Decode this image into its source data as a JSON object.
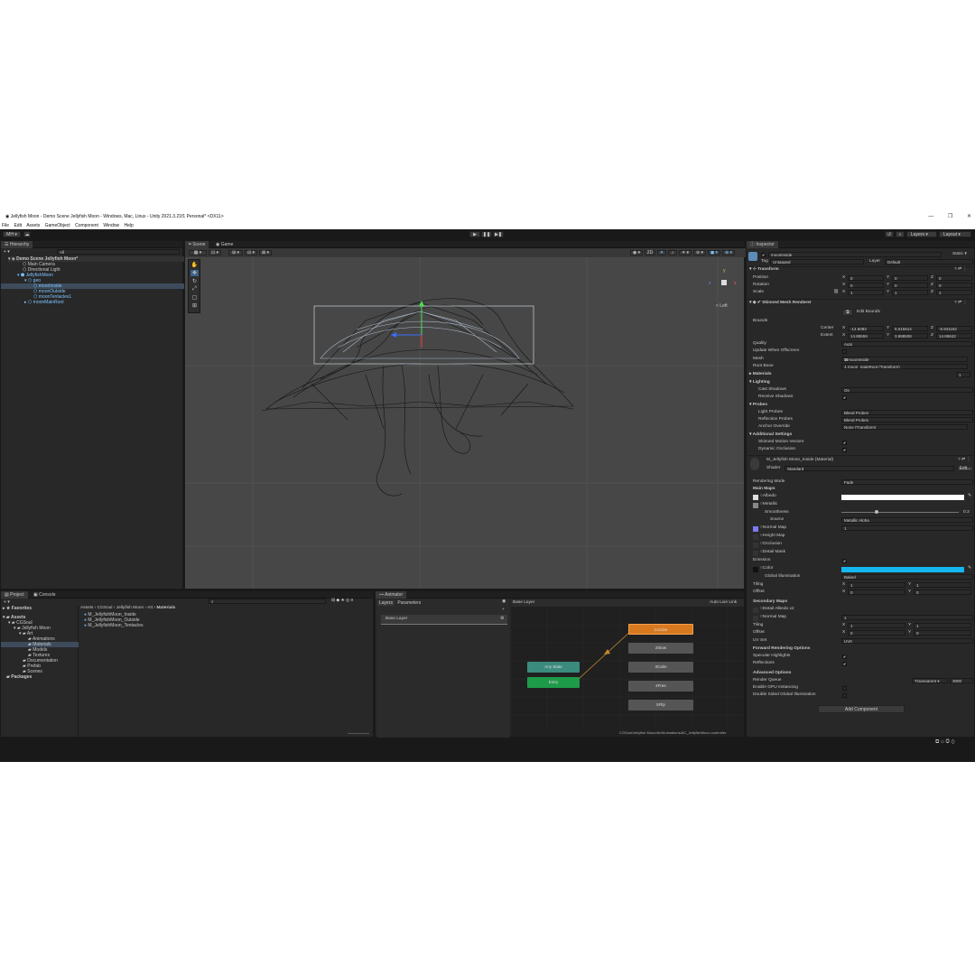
{
  "window": {
    "title": "Jellyfish Moon - Demo Scene Jellyfish Moon - Windows, Mac, Linux - Unity 2021.3.21f1 Personal* <DX11>",
    "controls": [
      "—",
      "❐",
      "✕"
    ]
  },
  "menu": [
    "File",
    "Edit",
    "Assets",
    "GameObject",
    "Component",
    "Window",
    "Help"
  ],
  "toolbar": {
    "account": "MH",
    "play": "▶",
    "pause": "❚❚",
    "step": "▶❚",
    "layers": "Layers",
    "layout": "Layout"
  },
  "hierarchy": {
    "tab": "Hierarchy",
    "add": "+ ▾",
    "search_placeholder": "All",
    "items": [
      {
        "label": "Demo Scene Jellyfish Moon*"
      },
      {
        "label": "Main Camera"
      },
      {
        "label": "Directional Light"
      },
      {
        "label": "JellyfishMoon"
      },
      {
        "label": "geo"
      },
      {
        "label": "moonInside"
      },
      {
        "label": "moonOutside"
      },
      {
        "label": "moonTentacles1"
      },
      {
        "label": "moonMainRoot"
      }
    ]
  },
  "scene": {
    "tabs": [
      "Scene",
      "Game"
    ],
    "persp_label": "< Left",
    "gizmo_axes": {
      "y": "y",
      "z": "z",
      "x": "x"
    },
    "tool_2d": "2D"
  },
  "inspector": {
    "tab": "Inspector",
    "object_name": "moonInside",
    "static": "Static ▾",
    "tag_label": "Tag",
    "tag": "Untagged",
    "layer_label": "Layer",
    "layer": "Default",
    "transform": {
      "title": "Transform",
      "position_label": "Position",
      "rotation_label": "Rotation",
      "scale_label": "Scale",
      "position": [
        "0",
        "0",
        "0"
      ],
      "rotation": [
        "0",
        "0",
        "0"
      ],
      "scale": [
        "1",
        "1",
        "1"
      ]
    },
    "renderer": {
      "title": "Skinned Mesh Renderer",
      "edit_bounds": "Edit Bounds",
      "bounds_label": "Bounds",
      "center_label": "Center",
      "extent_label": "Extent",
      "center": [
        "-14.5083",
        "5.015514",
        "-5.941182"
      ],
      "extent": [
        "14.85559",
        "3.988508",
        "14.89842"
      ],
      "quality_label": "Quality",
      "quality": "Auto",
      "update_offscreen": "Update When Offscreen",
      "mesh_label": "Mesh",
      "mesh": "moonInside",
      "root_bone_label": "Root Bone",
      "root_bone": "⅄ moon_mainRoot (Transform)",
      "materials": "Materials",
      "materials_count": "1",
      "lighting": "Lighting",
      "cast_shadows_label": "Cast Shadows",
      "cast_shadows": "On",
      "receive_shadows": "Receive Shadows",
      "probes": "Probes",
      "light_probes_label": "Light Probes",
      "light_probes": "Blend Probes",
      "reflection_probes_label": "Reflection Probes",
      "reflection_probes": "Blend Probes",
      "anchor_override_label": "Anchor Override",
      "anchor_override": "None (Transform)",
      "additional": "Additional Settings",
      "skinned_motion": "Skinned Motion Vectors",
      "dynamic_occlusion": "Dynamic Occlusion"
    },
    "material": {
      "name": "M_Jellyfish Moon_Inside (Material)",
      "shader_label": "Shader",
      "shader": "Standard",
      "edit": "Edit...",
      "rendering_mode_label": "Rendering Mode",
      "rendering_mode": "Fade",
      "main_maps": "Main Maps",
      "albedo": "Albedo",
      "metallic": "Metallic",
      "smoothness_label": "Smoothness",
      "smoothness": 0.3,
      "smoothness_text": "0.3",
      "source_label": "Source",
      "source": "Metallic Alpha",
      "normal_map": "Normal Map",
      "normal_value": "1",
      "height_map": "Height Map",
      "occlusion": "Occlusion",
      "detail_mask": "Detail Mask",
      "emission": "Emission",
      "color": "Color",
      "emission_color": "#15b7ef",
      "global_illum_label": "Global Illumination",
      "global_illum": "Baked",
      "tiling_label": "Tiling",
      "offset_label": "Offset",
      "tiling": [
        "1",
        "1"
      ],
      "offset": [
        "0",
        "0"
      ],
      "secondary_maps": "Secondary Maps",
      "detail_albedo": "Detail Albedo x2",
      "normal_map2": "Normal Map",
      "normal_value2": "1",
      "tiling2": [
        "1",
        "1"
      ],
      "offset2": [
        "0",
        "0"
      ],
      "uv_set_label": "UV Set",
      "uv_set": "UV0",
      "forward_options": "Forward Rendering Options",
      "specular": "Specular Highlights",
      "reflections": "Reflections",
      "advanced": "Advanced Options",
      "render_queue_label": "Render Queue",
      "render_queue_mode": "Transparent ▾",
      "render_queue": "3000",
      "gpu_instancing": "Enable GPU Instancing",
      "double_sided": "Double Sided Global Illumination"
    },
    "add_component": "Add Component"
  },
  "project": {
    "tabs": [
      "Project",
      "Console"
    ],
    "add": "+ ▾",
    "favorites": "Favorites",
    "tree": [
      {
        "label": "Assets"
      },
      {
        "label": "CGSoul"
      },
      {
        "label": "Jellyfish Moon"
      },
      {
        "label": "Art"
      },
      {
        "label": "Animations"
      },
      {
        "label": "Materials"
      },
      {
        "label": "Models"
      },
      {
        "label": "Textures"
      },
      {
        "label": "Documentation"
      },
      {
        "label": "Prefab"
      },
      {
        "label": "Scenes"
      },
      {
        "label": "Packages"
      }
    ],
    "breadcrumb": [
      "Assets",
      "CGSoul",
      "Jellyfish Moon",
      "Art",
      "Materials"
    ],
    "files": [
      "M_JellyfishMoon_Inside",
      "M_JellyfishMoon_Outside",
      "M_JellyfishMoon_Tentacles"
    ]
  },
  "animator": {
    "tab": "Animator",
    "subtabs": [
      "Layers",
      "Parameters"
    ],
    "layer": "Base Layer",
    "breadcrumb": "Base Layer",
    "auto_live": "Auto Live Link",
    "nodes": {
      "any_state": "Any State",
      "entry": "Entry",
      "s1": "1Active",
      "s2": "2Slow",
      "s3": "3Calm",
      "s4": "4Free",
      "s5": "5Flip"
    },
    "path": "CGSoul/Jellyfish Moon/Art/Animations/AC_JellyfishMoon.controller"
  },
  "colors": {
    "accent_orange": "#d9791f",
    "accent_green": "#1e9b49",
    "teal_state": "#3b8b7e",
    "selection": "#2c5d87"
  }
}
